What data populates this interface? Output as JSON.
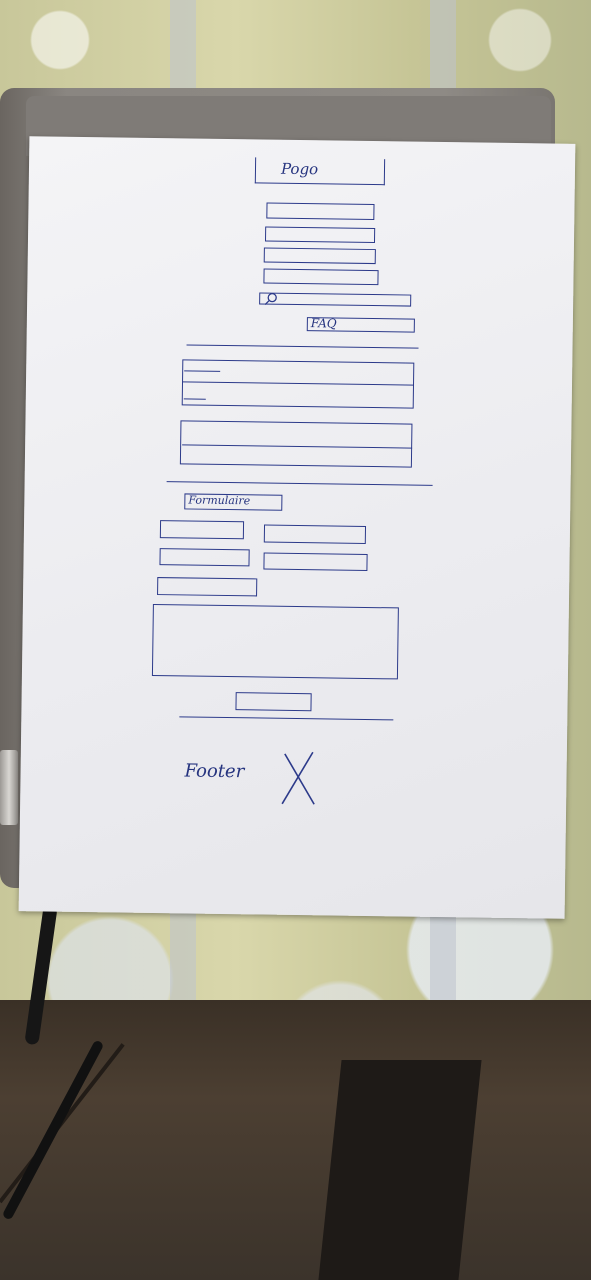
{
  "sketch": {
    "logo_label": "Pogo",
    "faq_label": "FAQ",
    "form_label": "Formulaire",
    "footer_label": "Footer"
  },
  "colors": {
    "ink": "#2c3a8a",
    "paper": "#efeff2",
    "laptop": "#8a8681"
  }
}
